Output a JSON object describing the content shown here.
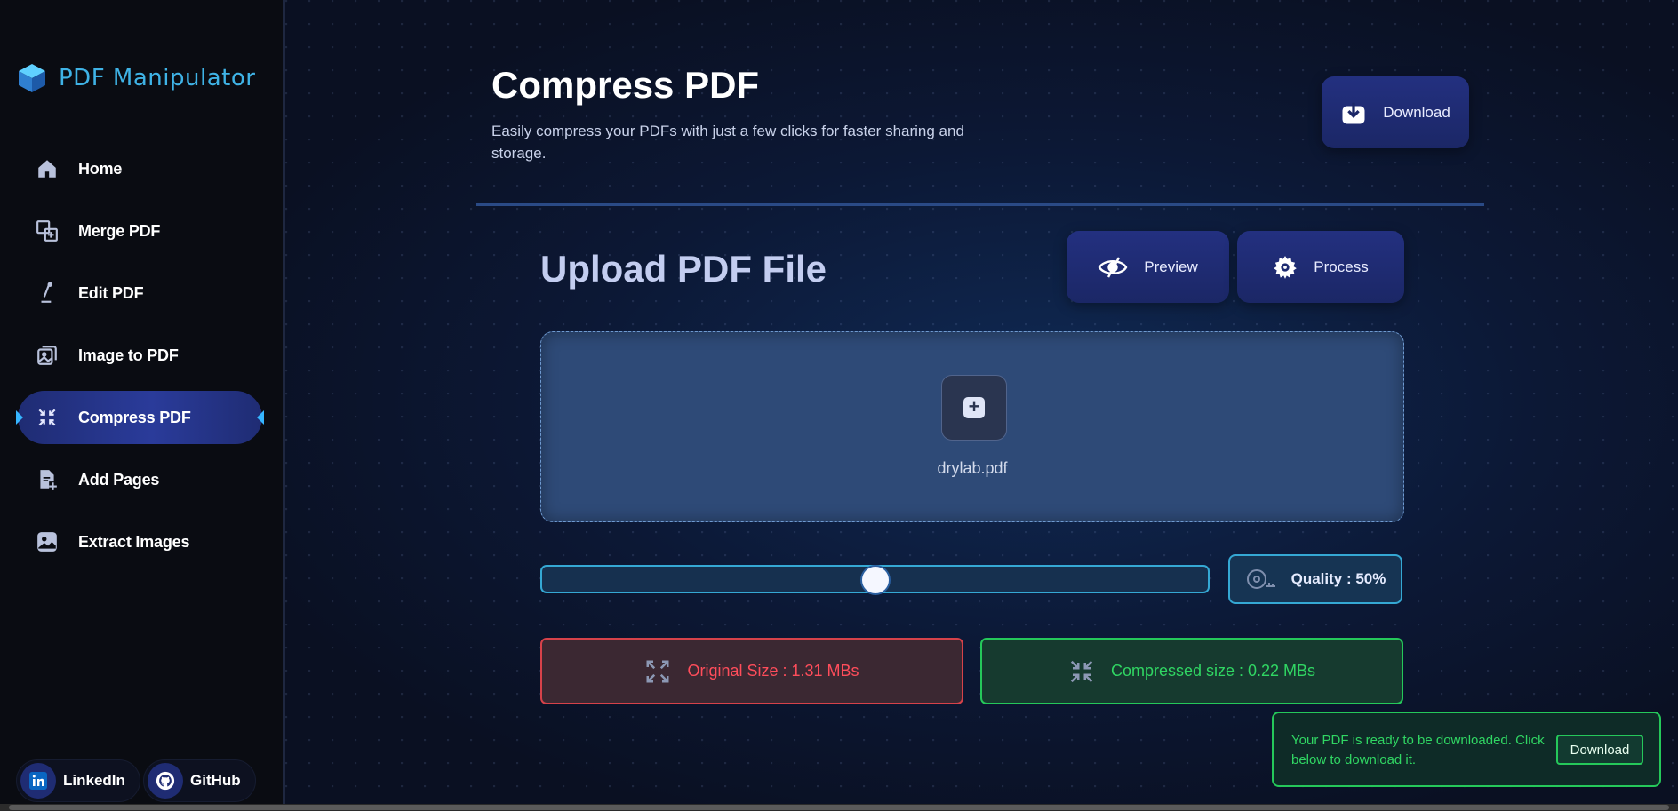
{
  "app": {
    "title": "PDF Manipulator"
  },
  "sidebar": {
    "items": [
      {
        "label": "Home",
        "icon": "home-icon"
      },
      {
        "label": "Merge PDF",
        "icon": "merge-icon"
      },
      {
        "label": "Edit PDF",
        "icon": "pen-icon"
      },
      {
        "label": "Image to PDF",
        "icon": "image-stack-icon"
      },
      {
        "label": "Compress PDF",
        "icon": "compress-icon",
        "active": true
      },
      {
        "label": "Add Pages",
        "icon": "add-page-icon"
      },
      {
        "label": "Extract Images",
        "icon": "image-icon"
      }
    ],
    "social": {
      "linkedin": "LinkedIn",
      "github": "GitHub"
    }
  },
  "header": {
    "title": "Compress PDF",
    "subtitle": "Easily compress your PDFs with just a few clicks for faster sharing and storage.",
    "download_label": "Download"
  },
  "upload": {
    "title": "Upload PDF File",
    "preview_label": "Preview",
    "process_label": "Process",
    "filename": "drylab.pdf"
  },
  "quality": {
    "label": "Quality : 50%",
    "value": 0.5
  },
  "sizes": {
    "original": "Original Size : 1.31 MBs",
    "compressed": "Compressed size : 0.22 MBs"
  },
  "toast": {
    "message": "Your PDF is ready to be downloaded. Click below to download it.",
    "button": "Download"
  },
  "colors": {
    "accent": "#3fb3e6",
    "active_nav": "#2a3b9a",
    "error": "#ff4d5b",
    "success": "#30d663"
  }
}
